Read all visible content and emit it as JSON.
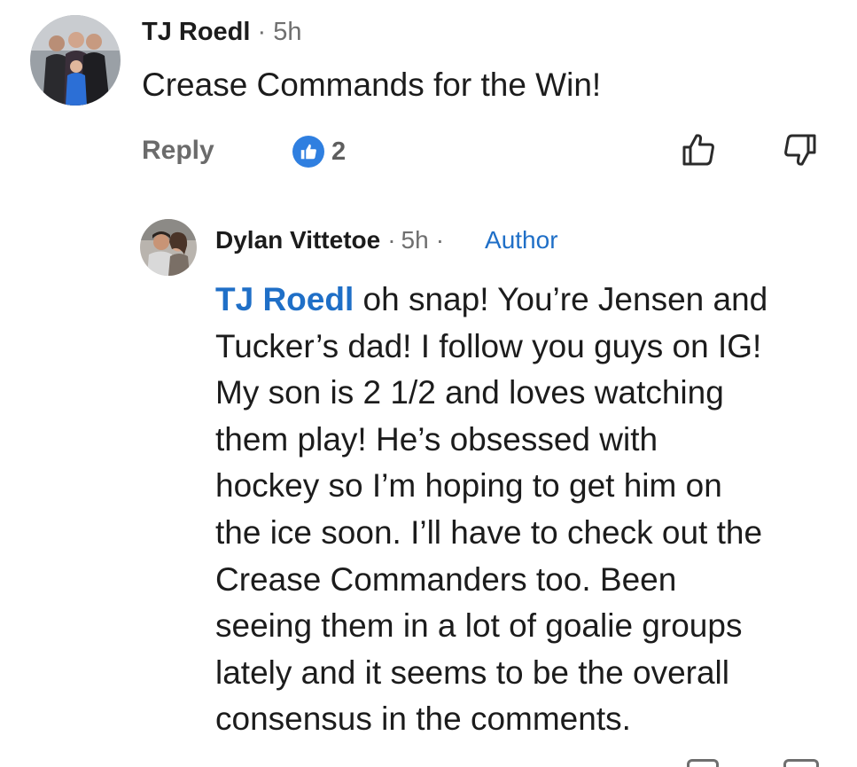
{
  "comment": {
    "author": "TJ Roedl",
    "separator": "·",
    "time": "5h",
    "text": "Crease Commands for the Win!",
    "reply_label": "Reply",
    "like_count": "2"
  },
  "reply": {
    "author": "Dylan Vittetoe",
    "separator": "·",
    "time": "5h",
    "separator2": "·",
    "author_badge": "Author",
    "mention": "TJ Roedl",
    "lines": [
      " oh snap! You’re Jensen and",
      "Tucker’s dad! I follow you guys on IG!",
      "My son is 2 1/2 and loves watching",
      "them play! He’s obsessed with",
      "hockey so I’m hoping to get him on",
      "the ice soon. I’ll have to check out the",
      "Crease Commanders too. Been",
      "seeing them in a lot of goalie groups",
      "lately and it seems to be the overall",
      "consensus in the comments."
    ]
  },
  "icons": {
    "like_badge": "thumbs-up-icon",
    "thumb_up": "thumbs-up-outline-icon",
    "thumb_down": "thumbs-down-outline-icon"
  },
  "colors": {
    "link_blue": "#1f6fc7",
    "like_blue": "#2f7fe0",
    "muted_gray": "#6f6f6f",
    "text": "#1c1c1c"
  }
}
